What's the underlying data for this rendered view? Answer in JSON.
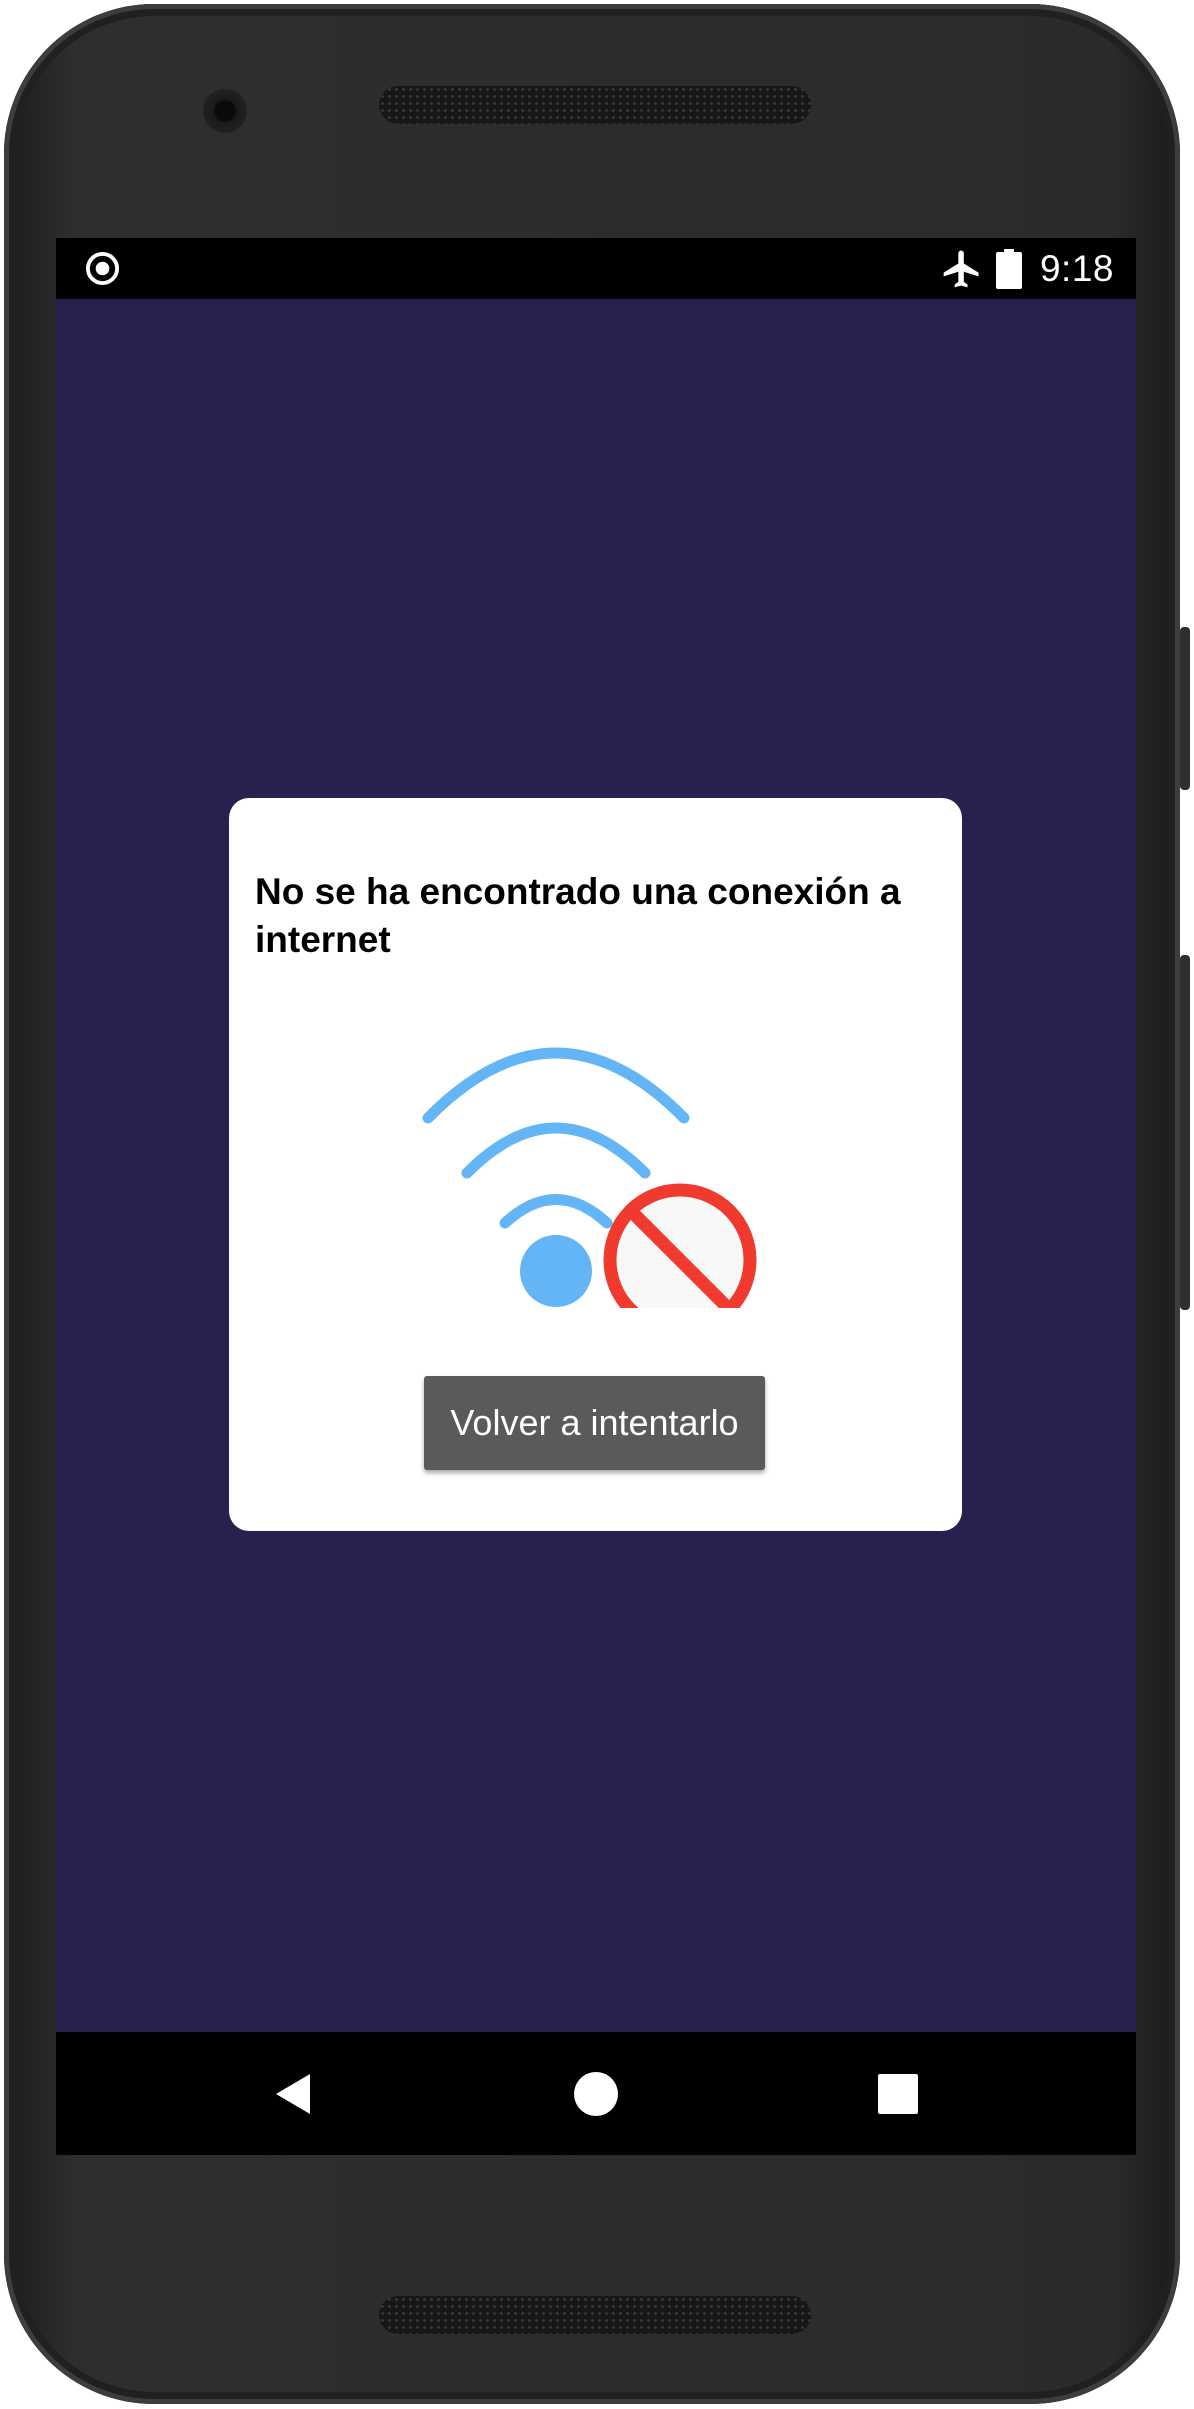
{
  "status_bar": {
    "time": "9:18",
    "icons": [
      "recording-icon",
      "airplane-mode-icon",
      "battery-icon"
    ]
  },
  "dialog": {
    "title": "No se ha encontrado una conexión a internet",
    "illustration": "wifi-off-icon",
    "retry_button_label": "Volver a intentarlo"
  },
  "nav_bar": {
    "buttons": [
      "back",
      "home",
      "recents"
    ]
  },
  "colors": {
    "screen_background": "#29204f",
    "wifi_blue": "#64b5f6",
    "prohibition_red": "#f03a2e",
    "button_gray": "#5a5a5a"
  }
}
